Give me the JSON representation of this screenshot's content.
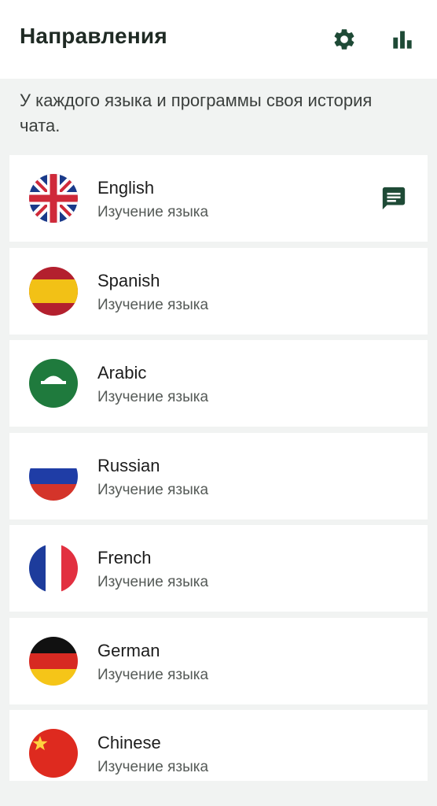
{
  "header": {
    "title": "Направления",
    "settings_icon": "gear-icon",
    "stats_icon": "bar-chart-icon"
  },
  "intro": {
    "text": "У каждого языка и программы своя история чата."
  },
  "theme": {
    "accent": "#1e4a36",
    "background": "#f1f3f2",
    "card": "#ffffff"
  },
  "courses": [
    {
      "name": "English",
      "subtitle": "Изучение языка",
      "flag": "uk-flag-icon",
      "has_chat": true,
      "chat_icon": "chat-bubble-icon"
    },
    {
      "name": "Spanish",
      "subtitle": "Изучение языка",
      "flag": "spain-flag-icon",
      "has_chat": false
    },
    {
      "name": "Arabic",
      "subtitle": "Изучение языка",
      "flag": "arabic-flag-icon",
      "has_chat": false
    },
    {
      "name": "Russian",
      "subtitle": "Изучение языка",
      "flag": "russia-flag-icon",
      "has_chat": false
    },
    {
      "name": "French",
      "subtitle": "Изучение языка",
      "flag": "france-flag-icon",
      "has_chat": false
    },
    {
      "name": "German",
      "subtitle": "Изучение языка",
      "flag": "germany-flag-icon",
      "has_chat": false
    },
    {
      "name": "Chinese",
      "subtitle": "Изучение языка",
      "flag": "china-flag-icon",
      "has_chat": false
    }
  ]
}
